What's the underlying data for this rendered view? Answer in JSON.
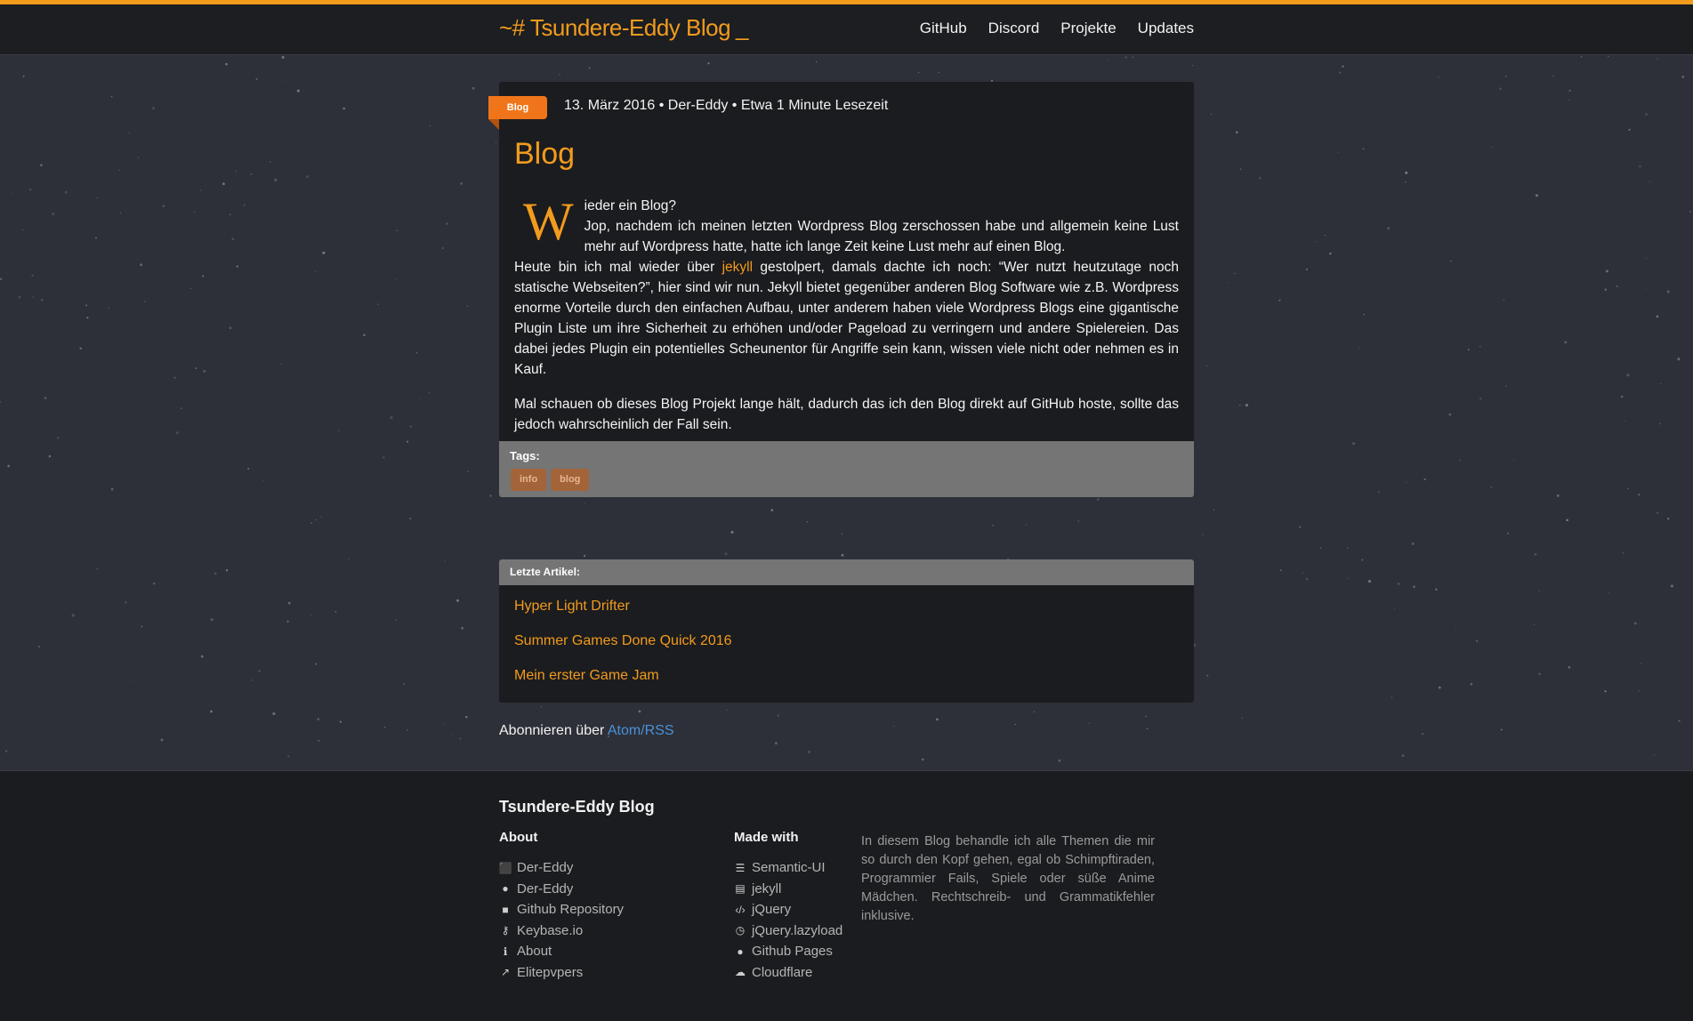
{
  "site": {
    "brand": "~# Tsundere-Eddy Blog",
    "cursor": "_"
  },
  "nav": {
    "items": [
      "GitHub",
      "Discord",
      "Projekte",
      "Updates"
    ]
  },
  "post": {
    "category_ribbon": "Blog",
    "meta": "13. März 2016 • Der-Eddy • Etwa 1 Minute Lesezeit",
    "title": "Blog",
    "dropcap": "W",
    "p1_line1": "ieder ein Blog?",
    "p1_line2": "Jop, nachdem ich meinen letzten Wordpress Blog zerschossen habe und allgemein keine Lust mehr auf Wordpress hatte, hatte ich lange Zeit keine Lust mehr auf einen Blog.",
    "p2_before": "Heute bin ich mal wieder über ",
    "p2_link": "jekyll",
    "p2_after": " gestolpert, damals dachte ich noch: “Wer nutzt heutzutage noch statische Webseiten?”, hier sind wir nun. Jekyll bietet gegenüber anderen Blog Software wie z.B. Wordpress enorme Vorteile durch den einfachen Aufbau, unter anderem haben viele Wordpress Blogs eine gigantische Plugin Liste um ihre Sicherheit zu erhöhen und/oder Pageload zu verringern und andere Spielereien. Das dabei jedes Plugin ein potentielles Scheunentor für Angriffe sein kann, wissen viele nicht oder nehmen es in Kauf.",
    "p3": "Mal schauen ob dieses Blog Projekt lange hält, dadurch das ich den Blog direkt auf GitHub hoste, sollte das jedoch wahrscheinlich der Fall sein.",
    "tags_label": "Tags:",
    "tags": [
      "info",
      "blog"
    ]
  },
  "recent": {
    "heading": "Letzte Artikel:",
    "items": [
      "Hyper Light Drifter",
      "Summer Games Done Quick 2016",
      "Mein erster Game Jam"
    ]
  },
  "subscribe": {
    "text": "Abonnieren über ",
    "link": "Atom/RSS"
  },
  "footer": {
    "title": "Tsundere-Eddy Blog",
    "about": {
      "heading": "About",
      "items": [
        {
          "icon": "steam-icon",
          "label": "Der-Eddy"
        },
        {
          "icon": "github-icon",
          "label": "Der-Eddy"
        },
        {
          "icon": "github-square-icon",
          "label": "Github Repository"
        },
        {
          "icon": "key-icon",
          "label": "Keybase.io"
        },
        {
          "icon": "info-icon",
          "label": "About"
        },
        {
          "icon": "external-link-icon",
          "label": "Elitepvpers"
        }
      ]
    },
    "made_with": {
      "heading": "Made with",
      "items": [
        {
          "icon": "css3-icon",
          "label": "Semantic-UI"
        },
        {
          "icon": "html5-icon",
          "label": "jekyll"
        },
        {
          "icon": "code-icon",
          "label": "jQuery"
        },
        {
          "icon": "clock-icon",
          "label": "jQuery.lazyload"
        },
        {
          "icon": "github-icon",
          "label": "Github Pages"
        },
        {
          "icon": "cloud-icon",
          "label": "Cloudflare"
        }
      ]
    },
    "description": "In diesem Blog behandle ich alle Themen die mir so durch den Kopf gehen, egal ob Schimpftiraden, Programmier Fails, Spiele oder süße Anime Mädchen. Rechtschreib- und Grammatikfehler inklusive."
  },
  "colors": {
    "accent": "#f29b1d",
    "ribbon": "#f0751a",
    "link_blue": "#4a90d9",
    "background": "#2d3038"
  }
}
